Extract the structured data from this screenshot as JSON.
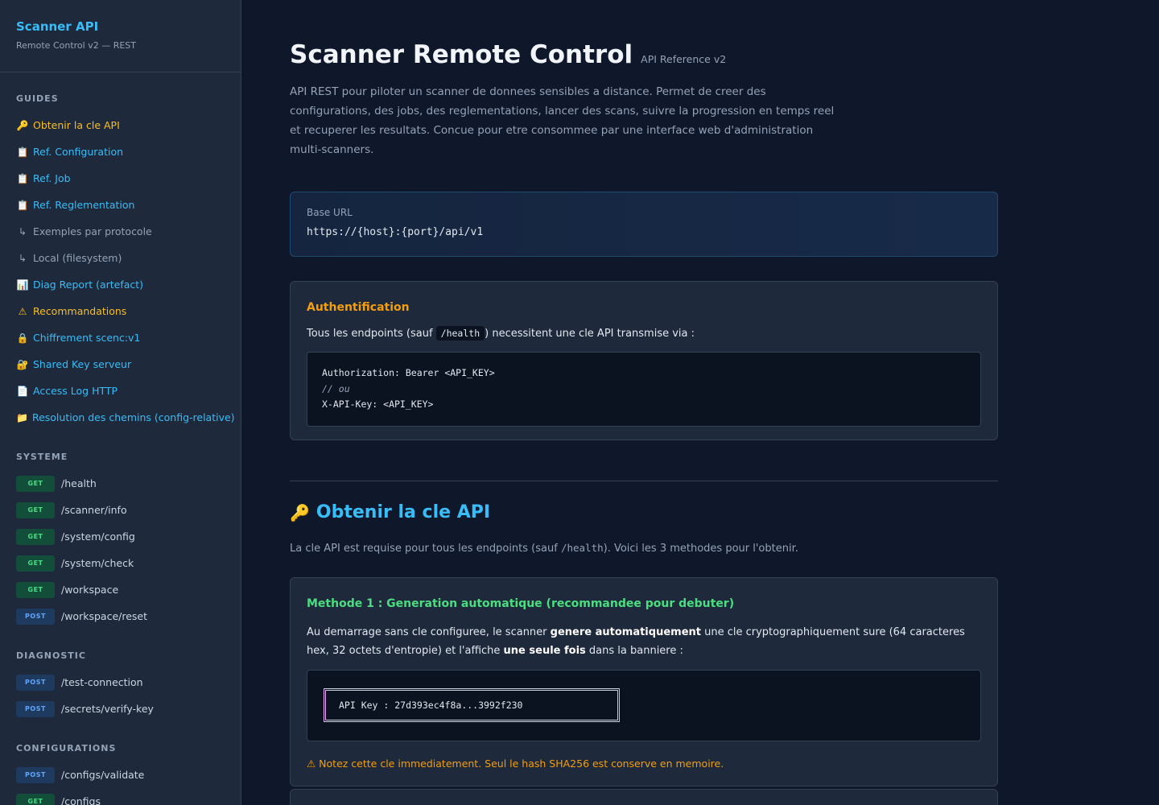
{
  "brand": {
    "title": "Scanner API",
    "subtitle": "Remote Control v2 — REST"
  },
  "sidebar": {
    "guides_title": "GUIDES",
    "guides": [
      {
        "icon": "🔑",
        "icon_name": "key-icon",
        "label": "Obtenir la cle API",
        "style": "orange"
      },
      {
        "icon": "📋",
        "icon_name": "clipboard-icon",
        "label": "Ref. Configuration",
        "style": "blue"
      },
      {
        "icon": "📋",
        "icon_name": "clipboard-icon",
        "label": "Ref. Job",
        "style": "blue"
      },
      {
        "icon": "📋",
        "icon_name": "clipboard-icon",
        "label": "Ref. Reglementation",
        "style": "blue"
      },
      {
        "icon": "↳",
        "icon_name": "sub-arrow-icon",
        "label": "Exemples par protocole",
        "style": "gray"
      },
      {
        "icon": "↳",
        "icon_name": "sub-arrow-icon",
        "label": "Local (filesystem)",
        "style": "gray"
      },
      {
        "icon": "📊",
        "icon_name": "chart-icon",
        "label": "Diag Report (artefact)",
        "style": "blue"
      },
      {
        "icon": "⚠",
        "icon_name": "warning-icon",
        "label": "Recommandations",
        "style": "orange"
      },
      {
        "icon": "🔒",
        "icon_name": "lock-icon",
        "label": "Chiffrement scenc:v1",
        "style": "blue"
      },
      {
        "icon": "🔐",
        "icon_name": "shared-key-icon",
        "label": "Shared Key serveur",
        "style": "blue"
      },
      {
        "icon": "📄",
        "icon_name": "document-icon",
        "label": "Access Log HTTP",
        "style": "blue"
      },
      {
        "icon": "📁",
        "icon_name": "folder-icon",
        "label": "Resolution des chemins (config-relative)",
        "style": "blue"
      }
    ],
    "systeme_title": "SYSTEME",
    "systeme": [
      {
        "method": "GET",
        "path": "/health"
      },
      {
        "method": "GET",
        "path": "/scanner/info"
      },
      {
        "method": "GET",
        "path": "/system/config"
      },
      {
        "method": "GET",
        "path": "/system/check"
      },
      {
        "method": "GET",
        "path": "/workspace"
      },
      {
        "method": "POST",
        "path": "/workspace/reset"
      }
    ],
    "diagnostic_title": "DIAGNOSTIC",
    "diagnostic": [
      {
        "method": "POST",
        "path": "/test-connection"
      },
      {
        "method": "POST",
        "path": "/secrets/verify-key"
      }
    ],
    "configurations_title": "CONFIGURATIONS",
    "configurations": [
      {
        "method": "POST",
        "path": "/configs/validate"
      },
      {
        "method": "GET",
        "path": "/configs"
      }
    ]
  },
  "main": {
    "title": "Scanner Remote Control",
    "version": "API Reference v2",
    "intro": "API REST pour piloter un scanner de donnees sensibles a distance. Permet de creer des configurations, des jobs, des reglementations, lancer des scans, suivre la progression en temps reel et recuperer les resultats. Concue pour etre consommee par une interface web d'administration multi-scanners.",
    "base_url_label": "Base URL",
    "base_url": "https://{host}:{port}/api/v1",
    "auth": {
      "title": "Authentification",
      "text_before": "Tous les endpoints (sauf ",
      "text_code": "/health",
      "text_after": ") necessitent une cle API transmise via :",
      "code_line1": "Authorization: Bearer <API_KEY>",
      "code_comment": "// ou",
      "code_line3": "X-API-Key: <API_KEY>"
    },
    "api_key_section": {
      "icon": "🔑",
      "title": "Obtenir la cle API",
      "desc_before": "La cle API est requise pour tous les endpoints (sauf ",
      "desc_code": "/health",
      "desc_after": "). Voici les 3 methodes pour l'obtenir."
    },
    "method1": {
      "title": "Methode 1 : Generation automatique (recommandee pour debuter)",
      "text_a": "Au demarrage sans cle configuree, le scanner ",
      "text_b": "genere automatiquement",
      "text_c": " une cle cryptographiquement sure (64 caracteres hex, 32 octets d'entropie) et l'affiche ",
      "text_d": "une seule fois",
      "text_e": " dans la banniere :",
      "banner": "API Key : 27d393ec4f8a...3992f230",
      "warning": "⚠ Notez cette cle immediatement. Seul le hash SHA256 est conserve en memoire."
    }
  },
  "colors": {
    "accent_blue": "#38bdf8",
    "accent_orange": "#f59e0b",
    "accent_green": "#4ade80",
    "background": "#0f172a",
    "sidebar": "#1e293b"
  }
}
